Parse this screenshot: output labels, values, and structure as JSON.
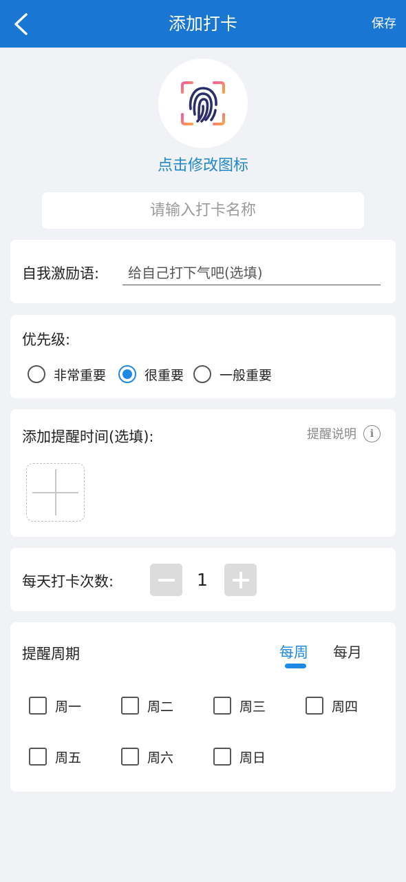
{
  "header": {
    "back_label": "<",
    "title": "添加打卡",
    "save_label": "保存"
  },
  "icon_picker": {
    "icon": "fingerprint-icon",
    "change_label": "点击修改图标"
  },
  "name_input": {
    "placeholder": "请输入打卡名称",
    "value": ""
  },
  "motto": {
    "label": "自我激励语:",
    "placeholder": "给自己打下气吧(选填)",
    "value": ""
  },
  "priority": {
    "label": "优先级:",
    "options": [
      {
        "label": "非常重要",
        "selected": false
      },
      {
        "label": "很重要",
        "selected": true
      },
      {
        "label": "一般重要",
        "selected": false
      }
    ],
    "accent": "#1e88e5"
  },
  "reminder": {
    "label": "添加提醒时间(选填):",
    "help_label": "提醒说明",
    "info_icon": "info-icon",
    "add_icon": "plus-icon"
  },
  "daily_count": {
    "label": "每天打卡次数:",
    "value": "1",
    "minus_icon": "minus-icon",
    "plus_icon": "plus-icon"
  },
  "period": {
    "label": "提醒周期",
    "tabs": [
      {
        "label": "每周",
        "active": true
      },
      {
        "label": "每月",
        "active": false
      }
    ],
    "days": [
      "周一",
      "周二",
      "周三",
      "周四",
      "周五",
      "周六",
      "周日"
    ]
  },
  "colors": {
    "header_bg": "#1976d2",
    "accent": "#1e88e5",
    "page_bg": "#f1f2f6"
  }
}
